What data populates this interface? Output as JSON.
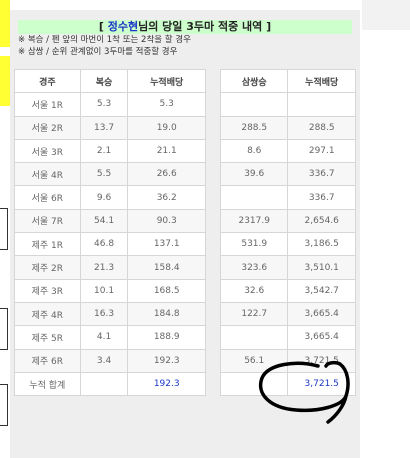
{
  "title": {
    "bracket_open": "[ ",
    "name": "정수현",
    "rest": "님의 당일 3두마 적중 내역 ]"
  },
  "notes": [
    "※ 복승 / 펜 앞의 마번이 1착 또는 2착을 할 경우",
    "※ 삼쌍 / 순위 관계없이 3두마를 적중할 경우"
  ],
  "left_table": {
    "headers": [
      "경주",
      "복승",
      "누적배당"
    ],
    "rows": [
      [
        "서울 1R",
        "5.3",
        "5.3"
      ],
      [
        "서울 2R",
        "13.7",
        "19.0"
      ],
      [
        "서울 3R",
        "2.1",
        "21.1"
      ],
      [
        "서울 4R",
        "5.5",
        "26.6"
      ],
      [
        "서울 6R",
        "9.6",
        "36.2"
      ],
      [
        "서울 7R",
        "54.1",
        "90.3"
      ],
      [
        "제주 1R",
        "46.8",
        "137.1"
      ],
      [
        "제주 2R",
        "21.3",
        "158.4"
      ],
      [
        "제주 3R",
        "10.1",
        "168.5"
      ],
      [
        "제주 4R",
        "16.3",
        "184.8"
      ],
      [
        "제주 5R",
        "4.1",
        "188.9"
      ],
      [
        "제주 6R",
        "3.4",
        "192.3"
      ]
    ],
    "total": [
      "누적 합계",
      "",
      "192.3"
    ]
  },
  "right_table": {
    "headers": [
      "삼쌍승",
      "누적배당"
    ],
    "rows": [
      [
        "",
        ""
      ],
      [
        "288.5",
        "288.5"
      ],
      [
        "8.6",
        "297.1"
      ],
      [
        "39.6",
        "336.7"
      ],
      [
        "",
        "336.7"
      ],
      [
        "2317.9",
        "2,654.6"
      ],
      [
        "531.9",
        "3,186.5"
      ],
      [
        "323.6",
        "3,510.1"
      ],
      [
        "32.6",
        "3,542.7"
      ],
      [
        "122.7",
        "3,665.4"
      ],
      [
        "",
        "3,665.4"
      ],
      [
        "56.1",
        "3,721.5"
      ]
    ],
    "total": [
      "",
      "3,721.5"
    ]
  },
  "colors": {
    "title_bg": "#ccffcc",
    "title_name": "#1a37c8",
    "total_value": "#1a37c8",
    "side_highlight": "#ffff33",
    "scribble": "#000000"
  }
}
